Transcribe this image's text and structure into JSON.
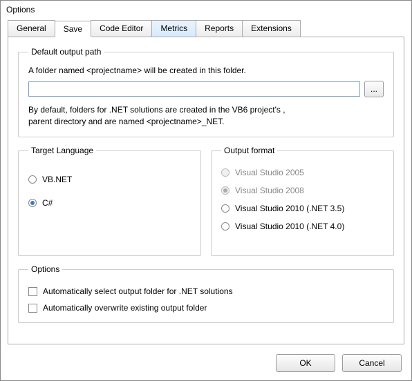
{
  "window": {
    "title": "Options"
  },
  "tabs": {
    "items": [
      {
        "label": "General"
      },
      {
        "label": "Save"
      },
      {
        "label": "Code Editor"
      },
      {
        "label": "Metrics"
      },
      {
        "label": "Reports"
      },
      {
        "label": "Extensions"
      }
    ],
    "active_index": 1,
    "highlight_index": 3
  },
  "default_output_path": {
    "legend": "Default output path",
    "intro": "A folder named <projectname> will be created in this folder.",
    "value": "",
    "browse_label": "...",
    "note_line1": "By default, folders for .NET solutions are created in the VB6 project's ,",
    "note_line2": "parent directory and are named <projectname>_NET."
  },
  "target_language": {
    "legend": "Target Language",
    "options": [
      {
        "label": "VB.NET",
        "selected": false,
        "enabled": true
      },
      {
        "label": "C#",
        "selected": true,
        "enabled": true
      }
    ]
  },
  "output_format": {
    "legend": "Output format",
    "options": [
      {
        "label": "Visual Studio 2005",
        "selected": false,
        "enabled": false
      },
      {
        "label": "Visual Studio 2008",
        "selected": true,
        "enabled": false
      },
      {
        "label": "Visual Studio 2010 (.NET 3.5)",
        "selected": false,
        "enabled": true
      },
      {
        "label": "Visual Studio 2010 (.NET 4.0)",
        "selected": false,
        "enabled": true
      }
    ]
  },
  "options_group": {
    "legend": "Options",
    "items": [
      {
        "label": "Automatically select output folder for .NET solutions",
        "checked": false
      },
      {
        "label": "Automatically overwrite existing output folder",
        "checked": false
      }
    ]
  },
  "buttons": {
    "ok": "OK",
    "cancel": "Cancel"
  }
}
